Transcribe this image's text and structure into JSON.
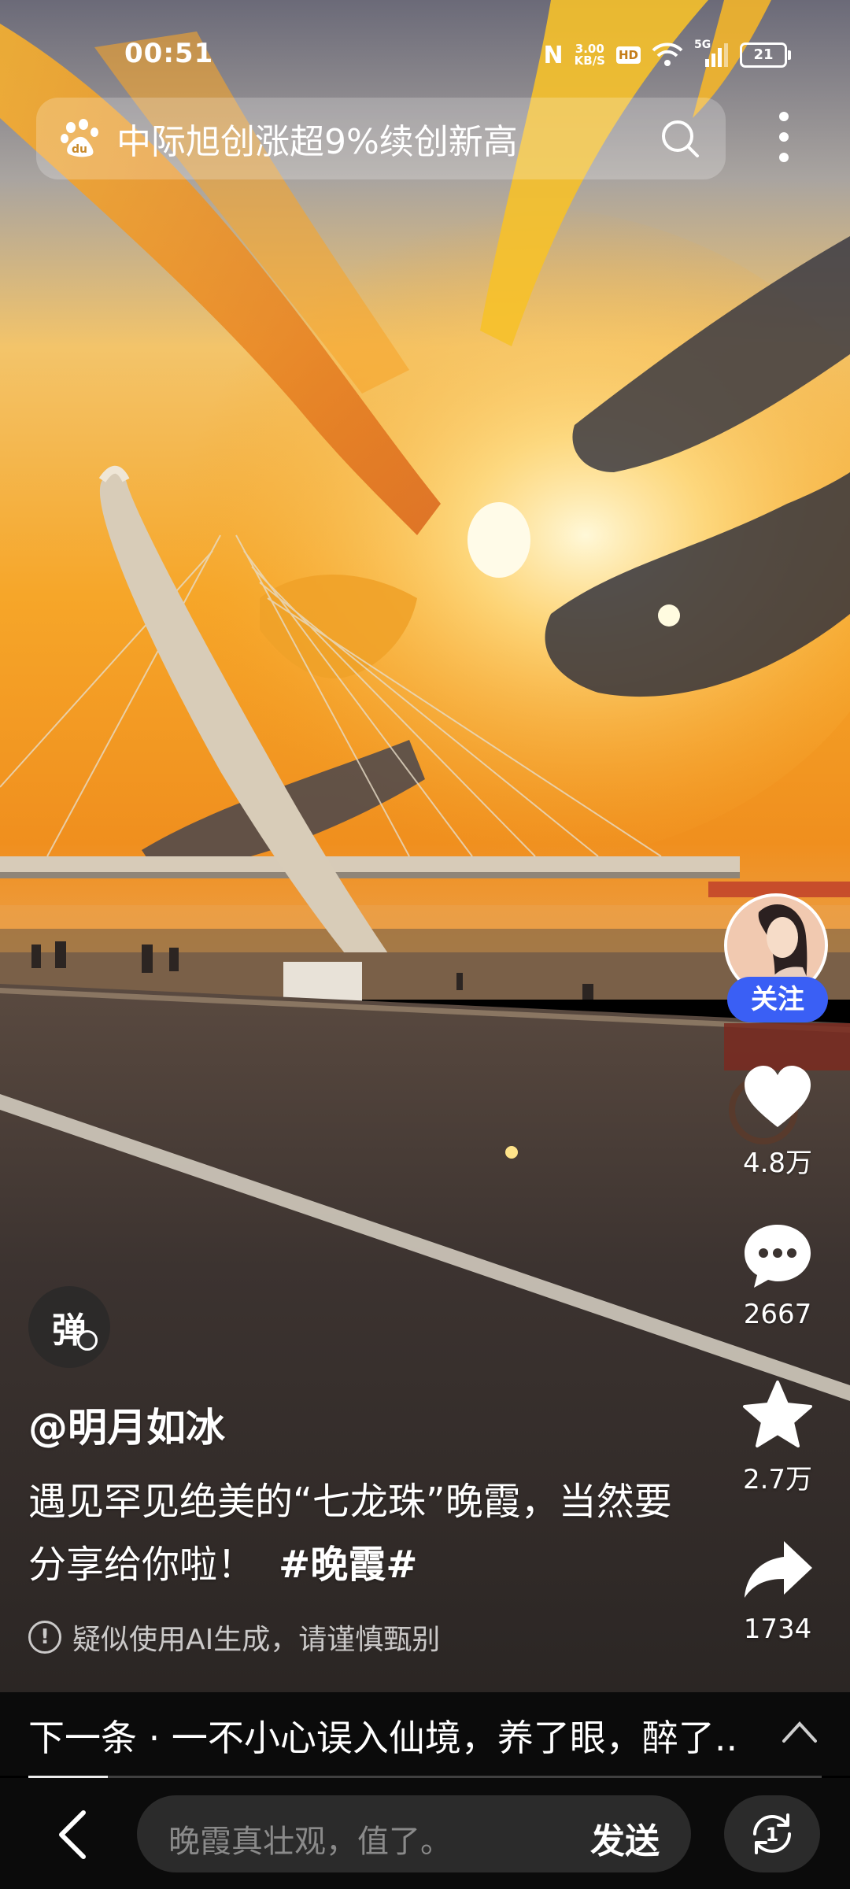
{
  "status_bar": {
    "time": "00:51",
    "nfc": "N",
    "net_speed_value": "3.00",
    "net_speed_unit": "KB/S",
    "hd": "HD",
    "signal": "5G",
    "battery": "21"
  },
  "search": {
    "query": "中际旭创涨超9%续创新高"
  },
  "actions": {
    "follow_label": "关注",
    "likes": "4.8万",
    "comments": "2667",
    "favorites": "2.7万",
    "shares": "1734"
  },
  "danmaku": {
    "label": "弹"
  },
  "post": {
    "author": "@明月如冰",
    "caption": "遇见罕见绝美的“七龙珠”晚霞，当然要分享给你啦！",
    "hashtag": "#晚霞#",
    "ai_notice": "疑似使用AI生成，请谨慎甄别",
    "ai_notice_icon": "!"
  },
  "next": {
    "text": "下一条 · 一不小心误入仙境，养了眼，醉了..."
  },
  "playback": {
    "progress_fraction": 0.1
  },
  "comment": {
    "placeholder": "晚霞真壮观，值了。",
    "send_label": "发送",
    "playlist_badge": "1"
  },
  "colors": {
    "follow_button": "#3a5ff5",
    "sky_gold": "#f4a62a",
    "road": "#3b3330"
  }
}
